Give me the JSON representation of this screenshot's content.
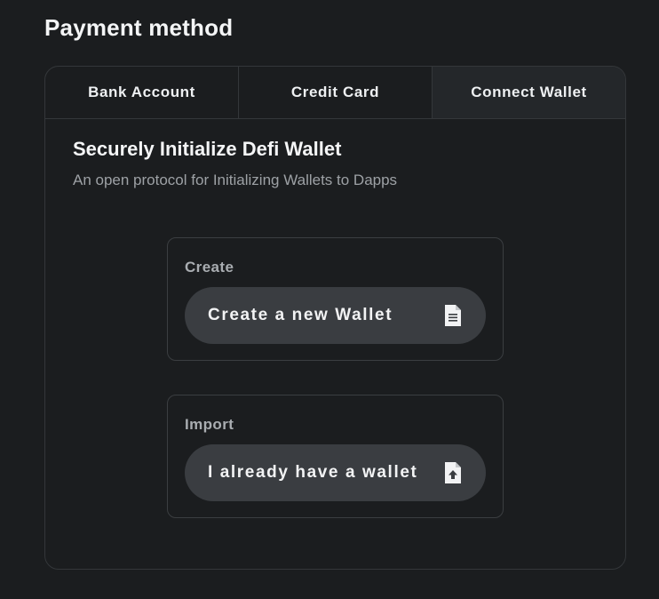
{
  "header": {
    "title": "Payment method"
  },
  "tabs": [
    {
      "label": "Bank Account",
      "active": false
    },
    {
      "label": "Credit Card",
      "active": false
    },
    {
      "label": "Connect Wallet",
      "active": true
    }
  ],
  "wallet": {
    "title": "Securely Initialize Defi Wallet",
    "subtitle": "An open protocol for Initializing Wallets to Dapps",
    "create": {
      "label": "Create",
      "button_label": "Create a new Wallet",
      "icon": "document-icon"
    },
    "import": {
      "label": "Import",
      "button_label": "I already have a wallet",
      "icon": "file-upload-icon"
    }
  },
  "colors": {
    "background": "#1b1d1f",
    "active_tab": "#24272a",
    "button": "#3a3d41",
    "border": "#34373a"
  }
}
